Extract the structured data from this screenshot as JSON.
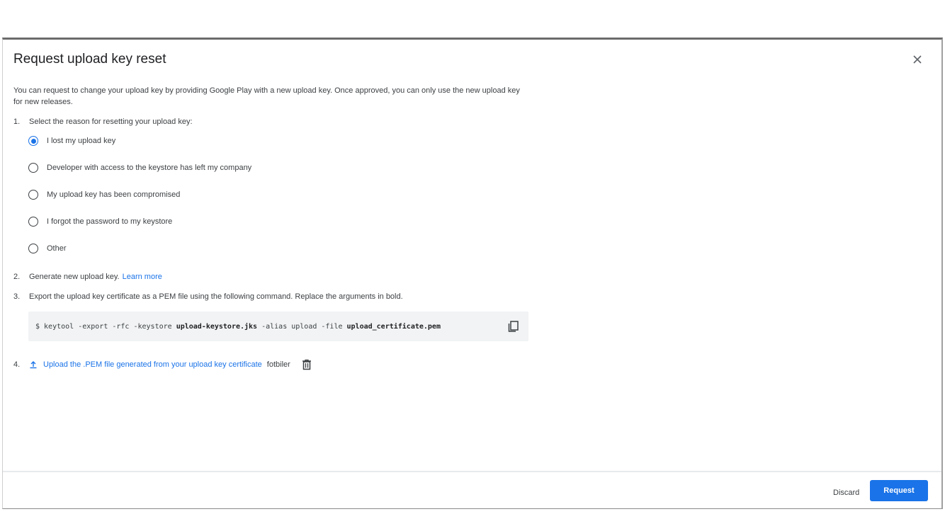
{
  "dialog": {
    "title": "Request upload key reset",
    "intro": "You can request to change your upload key by providing Google Play with a new upload key. Once approved, you can only use the new upload key for new releases."
  },
  "steps": [
    {
      "num": "1.",
      "text": "Select the reason for resetting your upload key:"
    },
    {
      "num": "2.",
      "text": "Generate new upload key.",
      "link": "Learn more"
    },
    {
      "num": "3.",
      "text": "Export the upload key certificate as a PEM file using the following command. Replace the arguments in bold."
    },
    {
      "num": "4."
    }
  ],
  "reasons": [
    {
      "label": "I lost my upload key",
      "selected": true
    },
    {
      "label": "Developer with access to the keystore has left my company",
      "selected": false
    },
    {
      "label": "My upload key has been compromised",
      "selected": false
    },
    {
      "label": "I forgot the password to my keystore",
      "selected": false
    },
    {
      "label": "Other",
      "selected": false
    }
  ],
  "command": {
    "p1": "$ keytool -export -rfc -keystore ",
    "b1": "upload-keystore.jks",
    "p2": " -alias upload -file ",
    "b2": "upload_certificate.pem"
  },
  "upload": {
    "label": "Upload the .PEM file generated from your upload key certificate",
    "filename": "fotbiler"
  },
  "footer": {
    "discard": "Discard",
    "request": "Request"
  },
  "icons": {
    "close": "close-icon",
    "copy": "copy-icon",
    "upload": "upload-icon",
    "trash": "trash-icon"
  },
  "colors": {
    "accent": "#1a73e8",
    "code_bg": "#f1f3f4"
  }
}
